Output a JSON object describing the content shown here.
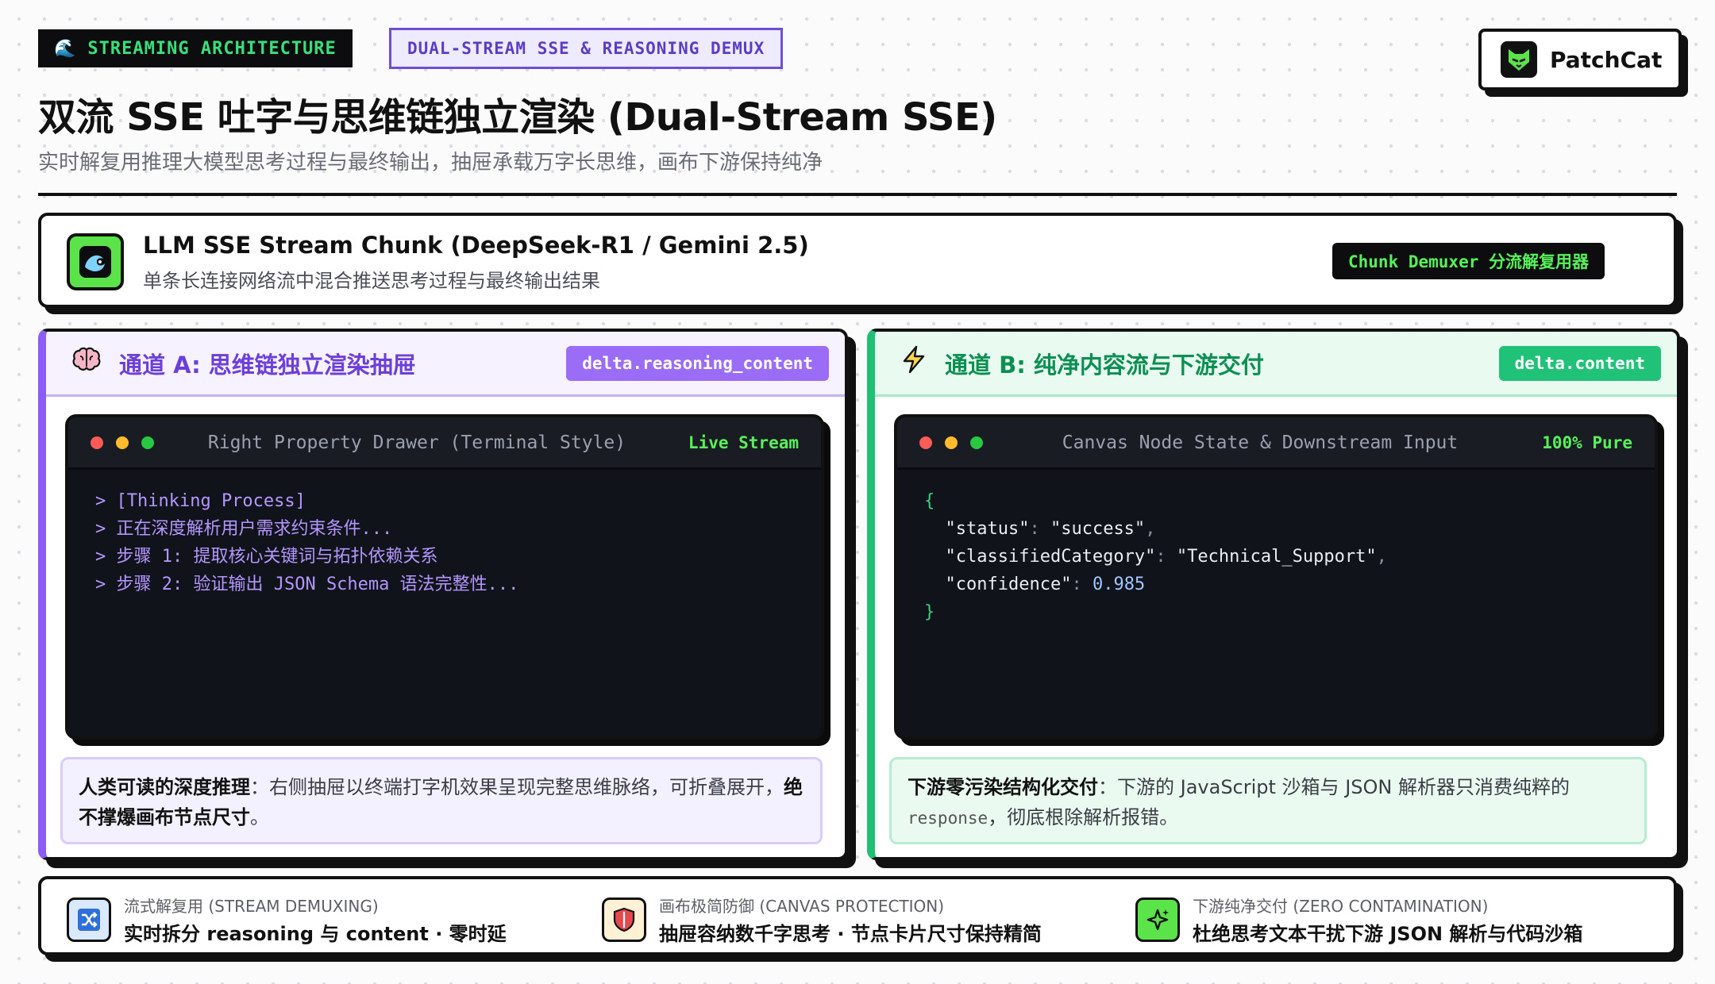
{
  "header": {
    "tag_primary": "STREAMING ARCHITECTURE",
    "tag_secondary": "DUAL-STREAM SSE & REASONING DEMUX",
    "title": "双流 SSE 吐字与思维链独立渲染 (Dual-Stream SSE)",
    "subtitle": "实时解复用推理大模型思考过程与最终输出，抽屉承载万字长思维，画布下游保持纯净",
    "brand": "PatchCat"
  },
  "source": {
    "title": "LLM SSE Stream Chunk (DeepSeek-R1 / Gemini 2.5)",
    "subtitle": "单条长连接网络流中混合推送思考过程与最终输出结果",
    "badge": "Chunk Demuxer 分流解复用器"
  },
  "channel_a": {
    "title": "通道 A: 思维链独立渲染抽屉",
    "field": "delta.reasoning_content",
    "terminal_title": "Right Property Drawer (Terminal Style)",
    "terminal_status": "Live Stream",
    "lines": [
      "> [Thinking Process]",
      "> 正在深度解析用户需求约束条件...",
      "> 步骤 1: 提取核心关键词与拓扑依赖关系",
      "> 步骤 2: 验证输出 JSON Schema 语法完整性..."
    ],
    "note_strong": "人类可读的深度推理",
    "note_text": "：右侧抽屉以终端打字机效果呈现完整思维脉络，可折叠展开，",
    "note_strong2": "绝不撑爆画布节点尺寸",
    "note_end": "。"
  },
  "channel_b": {
    "title": "通道 B: 纯净内容流与下游交付",
    "field": "delta.content",
    "terminal_title": "Canvas Node State & Downstream Input",
    "terminal_status": "100% Pure",
    "json": {
      "open": "{",
      "k1": "\"status\"",
      "v1": "\"success\"",
      "k2": "\"classifiedCategory\"",
      "v2": "\"Technical_Support\"",
      "k3": "\"confidence\"",
      "v3": "0.985",
      "close": "}"
    },
    "note_strong": "下游零污染结构化交付",
    "note_text": "：下游的 JavaScript 沙箱与 JSON 解析器只消费纯粹的",
    "note_code": "response",
    "note_end": "，彻底根除解析报错。"
  },
  "footer": {
    "items": [
      {
        "label": "流式解复用 (STREAM DEMUXING)",
        "desc": "实时拆分 reasoning 与 content · 零时延",
        "icon": "shuffle-icon",
        "color": "#dbe9ff"
      },
      {
        "label": "画布极简防御 (CANVAS PROTECTION)",
        "desc": "抽屉容纳数千字思考 · 节点卡片尺寸保持精简",
        "icon": "shield-icon",
        "color": "#fff1d6"
      },
      {
        "label": "下游纯净交付 (ZERO CONTAMINATION)",
        "desc": "杜绝思考文本干扰下游 JSON 解析与代码沙箱",
        "icon": "sparkle-icon",
        "color": "#5be34a"
      }
    ]
  },
  "colors": {
    "accent_purple": "#8b5cf6",
    "accent_green": "#1fbf74",
    "terminal_bg": "#11131a",
    "stream_green": "#57f25a"
  }
}
